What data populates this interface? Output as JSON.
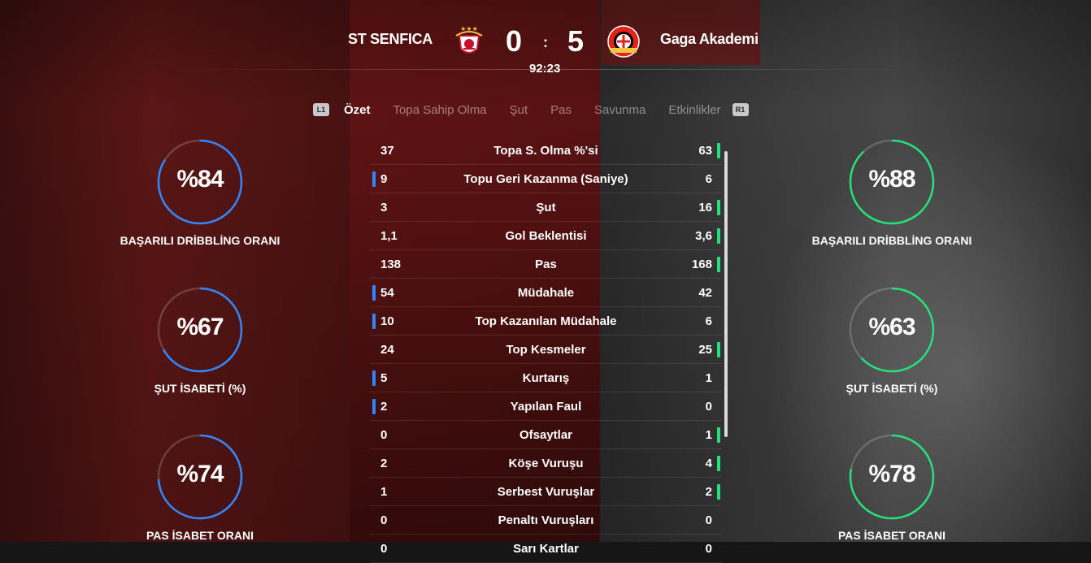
{
  "header": {
    "home_team": "ST SENFICA",
    "away_team": "Gaga Akademi",
    "home_score": "0",
    "away_score": "5",
    "separator": ":",
    "clock": "92:23"
  },
  "tabs": {
    "left_hint": "L1",
    "right_hint": "R1",
    "items": [
      "Özet",
      "Topa Sahip Olma",
      "Şut",
      "Pas",
      "Savunma",
      "Etkinlikler"
    ],
    "active": "Özet"
  },
  "colors": {
    "home_accent": "#2f86ff",
    "away_accent": "#25e07a"
  },
  "gauges": {
    "home": [
      {
        "value": "%84",
        "pct": 84,
        "label": "BAŞARILI DRİBBLİNG ORANI"
      },
      {
        "value": "%67",
        "pct": 67,
        "label": "ŞUT İSABETİ (%)"
      },
      {
        "value": "%74",
        "pct": 74,
        "label": "PAS İSABET ORANI"
      }
    ],
    "away": [
      {
        "value": "%88",
        "pct": 88,
        "label": "BAŞARILI DRİBBLİNG ORANI"
      },
      {
        "value": "%63",
        "pct": 63,
        "label": "ŞUT İSABETİ (%)"
      },
      {
        "value": "%78",
        "pct": 78,
        "label": "PAS İSABET ORANI"
      }
    ]
  },
  "stats": [
    {
      "home": "37",
      "label": "Topa S. Olma %'si",
      "away": "63",
      "leader": "away"
    },
    {
      "home": "9",
      "label": "Topu Geri Kazanma (Saniye)",
      "away": "6",
      "leader": "home"
    },
    {
      "home": "3",
      "label": "Şut",
      "away": "16",
      "leader": "away"
    },
    {
      "home": "1,1",
      "label": "Gol Beklentisi",
      "away": "3,6",
      "leader": "away"
    },
    {
      "home": "138",
      "label": "Pas",
      "away": "168",
      "leader": "away"
    },
    {
      "home": "54",
      "label": "Müdahale",
      "away": "42",
      "leader": "home"
    },
    {
      "home": "10",
      "label": "Top Kazanılan Müdahale",
      "away": "6",
      "leader": "home"
    },
    {
      "home": "24",
      "label": "Top Kesmeler",
      "away": "25",
      "leader": "away"
    },
    {
      "home": "5",
      "label": "Kurtarış",
      "away": "1",
      "leader": "home"
    },
    {
      "home": "2",
      "label": "Yapılan Faul",
      "away": "0",
      "leader": "home"
    },
    {
      "home": "0",
      "label": "Ofsaytlar",
      "away": "1",
      "leader": "away"
    },
    {
      "home": "2",
      "label": "Köşe Vuruşu",
      "away": "4",
      "leader": "away"
    },
    {
      "home": "1",
      "label": "Serbest Vuruşlar",
      "away": "2",
      "leader": "away"
    },
    {
      "home": "0",
      "label": "Penaltı Vuruşları",
      "away": "0",
      "leader": "none"
    },
    {
      "home": "0",
      "label": "Sarı Kartlar",
      "away": "0",
      "leader": "none"
    }
  ]
}
